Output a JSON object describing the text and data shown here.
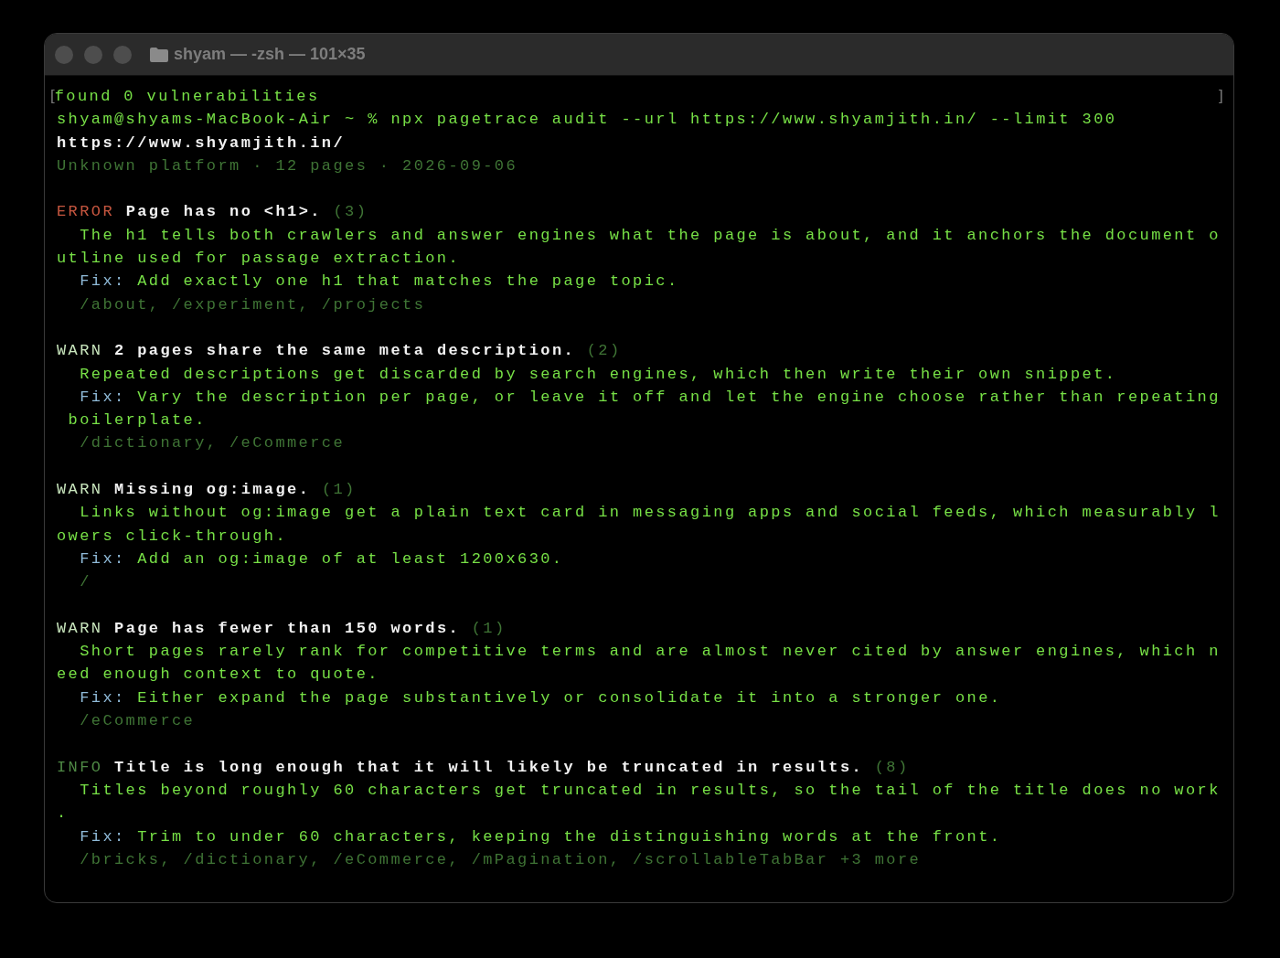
{
  "window": {
    "title": "shyam — -zsh — 101×35"
  },
  "terminal": {
    "lines": [
      {
        "kind": "output",
        "text": "found 0 vulnerabilities",
        "open_mark": "[",
        "close_mark": "]"
      },
      {
        "kind": "prompt",
        "text": "shyam@shyams-MacBook-Air ~ % npx pagetrace audit --url https://www.shyamjith.in/ --limit 300"
      },
      {
        "kind": "heading",
        "text": "https://www.shyamjith.in/"
      },
      {
        "kind": "meta",
        "text": "Unknown platform · 12 pages · 2026-09-06"
      }
    ],
    "issues": [
      {
        "severity": "ERROR",
        "title": "Page has no <h1>.",
        "count": "(3)",
        "body": "The h1 tells both crawlers and answer engines what the page is about, and it anchors the document outline used for passage extraction.",
        "fix_label": "Fix:",
        "fix": "Add exactly one h1 that matches the page topic.",
        "paths": "/about, /experiment, /projects"
      },
      {
        "severity": "WARN",
        "title": "2 pages share the same meta description.",
        "count": "(2)",
        "body": "Repeated descriptions get discarded by search engines, which then write their own snippet.",
        "fix_label": "Fix:",
        "fix": "Vary the description per page, or leave it off and let the engine choose rather than repeating boilerplate.",
        "paths": "/dictionary, /eCommerce"
      },
      {
        "severity": "WARN",
        "title": "Missing og:image.",
        "count": "(1)",
        "body": "Links without og:image get a plain text card in messaging apps and social feeds, which measurably lowers click-through.",
        "fix_label": "Fix:",
        "fix": "Add an og:image of at least 1200x630.",
        "paths": "/"
      },
      {
        "severity": "WARN",
        "title": "Page has fewer than 150 words.",
        "count": "(1)",
        "body": "Short pages rarely rank for competitive terms and are almost never cited by answer engines, which need enough context to quote.",
        "fix_label": "Fix:",
        "fix": "Either expand the page substantively or consolidate it into a stronger one.",
        "paths": "/eCommerce"
      },
      {
        "severity": "INFO",
        "title": "Title is long enough that it will likely be truncated in results.",
        "count": "(8)",
        "body": "Titles beyond roughly 60 characters get truncated in results, so the tail of the title does no work.",
        "fix_label": "Fix:",
        "fix": "Trim to under 60 characters, keeping the distinguishing words at the front.",
        "paths": "/bricks, /dictionary, /eCommerce, /mPagination, /scrollableTabBar +3 more"
      }
    ]
  }
}
